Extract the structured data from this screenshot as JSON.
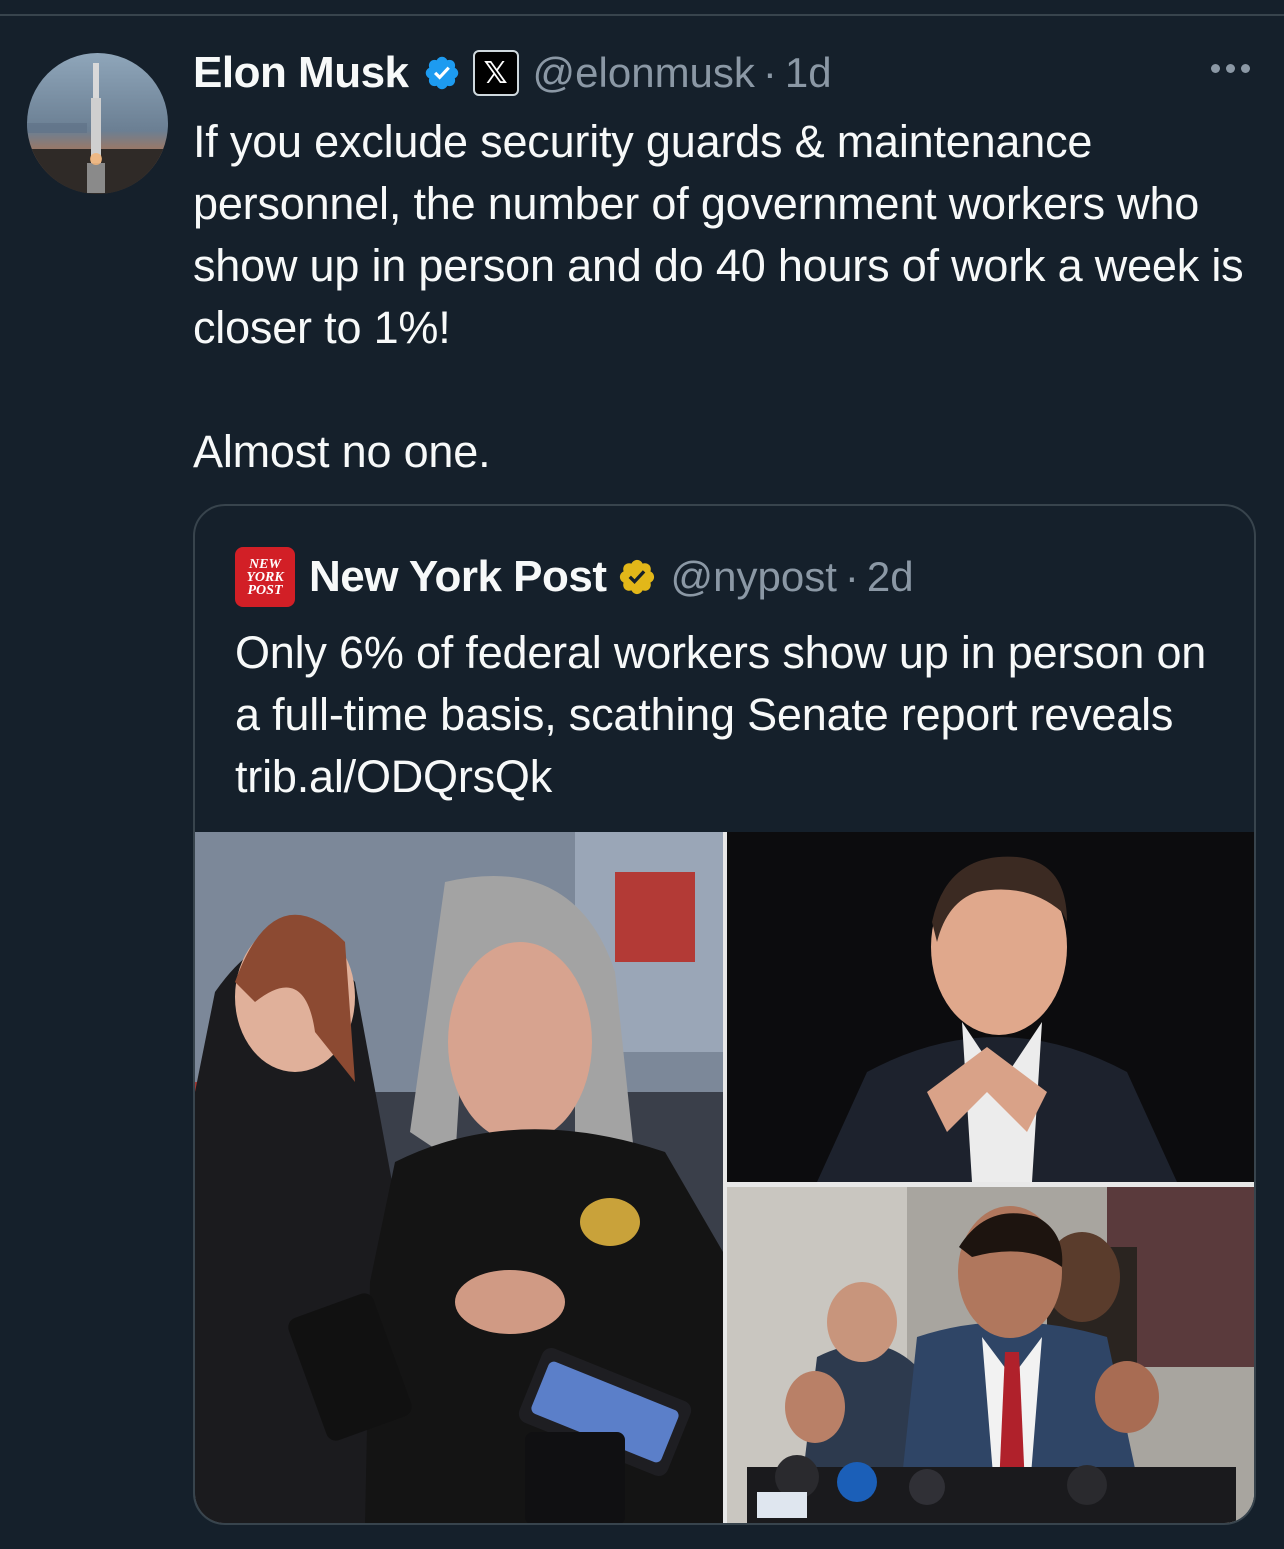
{
  "tweet": {
    "author": {
      "display_name": "Elon Musk",
      "handle": "@elonmusk",
      "verified_color": "#1d9bf0",
      "affiliate_badge": "𝕏"
    },
    "separator": "·",
    "time": "1d",
    "more_icon": "more-horizontal-icon",
    "text": "If you exclude security guards & maintenance personnel, the number of government workers who show up in person and do 40 hours of work a week is closer to 1%!\n\nAlmost no one."
  },
  "quote": {
    "logo_lines": [
      "NEW",
      "YORK",
      "POST"
    ],
    "display_name": "New York Post",
    "handle": "@nypost",
    "separator": "·",
    "time": "2d",
    "verified_color": "#e2b719",
    "text": "Only 6% of federal workers show up in person on a full-time basis, scathing Senate report reveals trib.al/ODQrsQk",
    "media": [
      {
        "name": "photo-woman-speaking"
      },
      {
        "name": "photo-man-hands-steepled"
      },
      {
        "name": "photo-man-at-podium"
      }
    ]
  },
  "colors": {
    "background": "#15202b",
    "text_primary": "#f7f9f9",
    "text_secondary": "#8b98a5",
    "border": "#38444d"
  }
}
